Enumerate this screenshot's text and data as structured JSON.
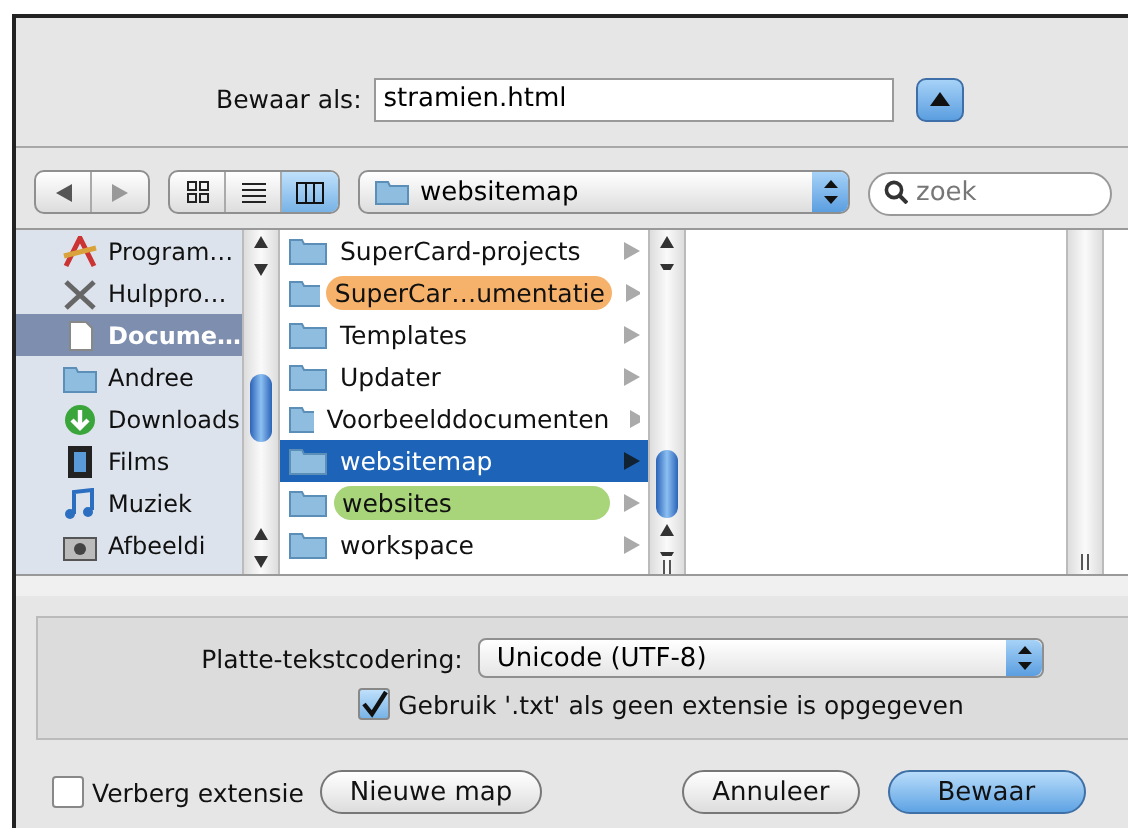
{
  "save_as": {
    "label": "Bewaar als:",
    "value": "stramien.html"
  },
  "toolbar": {
    "views": [
      {
        "kind": "icons",
        "selected": false
      },
      {
        "kind": "list",
        "selected": false
      },
      {
        "kind": "columns",
        "selected": true
      }
    ],
    "location": "websitemap",
    "search": {
      "placeholder": "zoek"
    }
  },
  "sidebar": {
    "items": [
      {
        "label": "Program…",
        "kind": "apps",
        "selected": false
      },
      {
        "label": "Hulppro…",
        "kind": "tools",
        "selected": false
      },
      {
        "label": "Docume…",
        "kind": "document",
        "selected": true
      },
      {
        "label": "Andree",
        "kind": "folder",
        "selected": false
      },
      {
        "label": "Downloads",
        "kind": "download",
        "selected": false
      },
      {
        "label": "Films",
        "kind": "film",
        "selected": false
      },
      {
        "label": "Muziek",
        "kind": "music",
        "selected": false
      },
      {
        "label": "Afbeeldi",
        "kind": "camera",
        "selected": false
      }
    ]
  },
  "files": [
    {
      "name": "SuperCard-projects",
      "selected": false
    },
    {
      "name": "SuperCar…umentatie",
      "selected": false,
      "color": "#f6b26b"
    },
    {
      "name": "Templates",
      "selected": false
    },
    {
      "name": "Updater",
      "selected": false
    },
    {
      "name": "Voorbeelddocumenten",
      "selected": false
    },
    {
      "name": "websitemap",
      "selected": true
    },
    {
      "name": "websites",
      "selected": false,
      "color": "#a8d47a"
    },
    {
      "name": "workspace",
      "selected": false
    }
  ],
  "encoding": {
    "label": "Platte-tekstcodering:",
    "value": "Unicode (UTF-8)"
  },
  "use_txt": {
    "label": "Gebruik '.txt' als geen extensie is opgegeven",
    "checked": true
  },
  "hide_extension": {
    "label": "Verberg extensie",
    "checked": false
  },
  "buttons": [
    {
      "label": "Nieuwe map",
      "kind": "plain"
    },
    {
      "label": "Annuleer",
      "kind": "plain"
    },
    {
      "label": "Bewaar",
      "kind": "default"
    }
  ]
}
